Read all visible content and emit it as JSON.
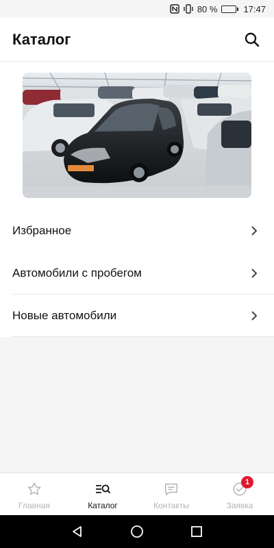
{
  "status_bar": {
    "battery_text": "80 %",
    "battery_level": 0.8,
    "time": "17:47",
    "icons": [
      "nfc-icon",
      "vibrate-icon",
      "battery-icon"
    ]
  },
  "app_bar": {
    "title": "Каталог",
    "search_icon": "search-icon"
  },
  "banner": {
    "image": "car-showroom-photo"
  },
  "menu": {
    "items": [
      {
        "label": "Избранное",
        "icon": "chevron-right-icon"
      },
      {
        "label": "Автомобили с пробегом",
        "icon": "chevron-right-icon"
      },
      {
        "label": "Новые автомобили",
        "icon": "chevron-right-icon"
      }
    ]
  },
  "bottom_nav": {
    "items": [
      {
        "label": "Главная",
        "icon": "star-icon",
        "active": false
      },
      {
        "label": "Каталог",
        "icon": "catalog-search-icon",
        "active": true
      },
      {
        "label": "Контакты",
        "icon": "chat-icon",
        "active": false
      },
      {
        "label": "Заявка",
        "icon": "check-circle-icon",
        "active": false,
        "badge": "1"
      }
    ]
  },
  "colors": {
    "background": "#f5f5f5",
    "surface": "#ffffff",
    "active_text": "#111111",
    "inactive_text": "#b3b3b3",
    "badge": "#e0182d"
  }
}
